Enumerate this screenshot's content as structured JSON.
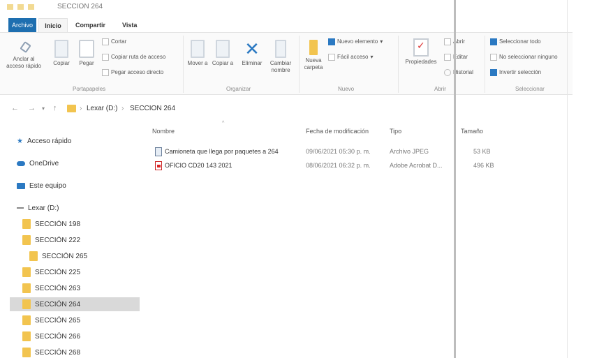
{
  "window": {
    "title": "SECCION 264"
  },
  "tabs": {
    "file": "Archivo",
    "home": "Inicio",
    "share": "Compartir",
    "view": "Vista"
  },
  "ribbon": {
    "clipboard": {
      "pin": "Anclar al acceso rápido",
      "copy": "Copiar",
      "paste": "Pegar",
      "cut": "Cortar",
      "copy_path": "Copiar ruta de acceso",
      "paste_shortcut": "Pegar acceso directo",
      "group": "Portapapeles"
    },
    "organize": {
      "move": "Mover a",
      "copy_to": "Copiar a",
      "delete": "Eliminar",
      "rename": "Cambiar nombre",
      "group": "Organizar"
    },
    "new": {
      "new_folder": "Nueva carpeta",
      "new_item": "Nuevo elemento",
      "easy_access": "Fácil acceso",
      "group": "Nuevo"
    },
    "open": {
      "properties": "Propiedades",
      "open": "Abrir",
      "edit": "Editar",
      "history": "Historial",
      "group": "Abrir"
    },
    "select": {
      "select_all": "Seleccionar todo",
      "select_none": "No seleccionar ninguno",
      "invert": "Invertir selección",
      "group": "Seleccionar"
    }
  },
  "address": {
    "drive": "Lexar (D:)",
    "folder": "SECCION 264"
  },
  "navigation": {
    "quick_access": "Acceso rápido",
    "onedrive": "OneDrive",
    "this_pc": "Este equipo",
    "drive": "Lexar (D:)",
    "folders": [
      "SECCIÓN 198",
      "SECCIÓN 222",
      "SECCIÓN 265",
      "SECCIÓN 225",
      "SECCIÓN 263",
      "SECCIÓN 264",
      "SECCIÓN 265",
      "SECCIÓN 266",
      "SECCIÓN 268"
    ]
  },
  "columns": {
    "name": "Nombre",
    "date": "Fecha de modificación",
    "type": "Tipo",
    "size": "Tamaño"
  },
  "files": [
    {
      "name": "Camioneta que llega por paquetes a 264",
      "date": "09/06/2021 05:30 p. m.",
      "type": "Archivo JPEG",
      "size": "53 KB"
    },
    {
      "name": "OFICIO CD20 143 2021",
      "date": "08/06/2021 06:32 p. m.",
      "type": "Adobe Acrobat D...",
      "size": "496 KB"
    }
  ]
}
